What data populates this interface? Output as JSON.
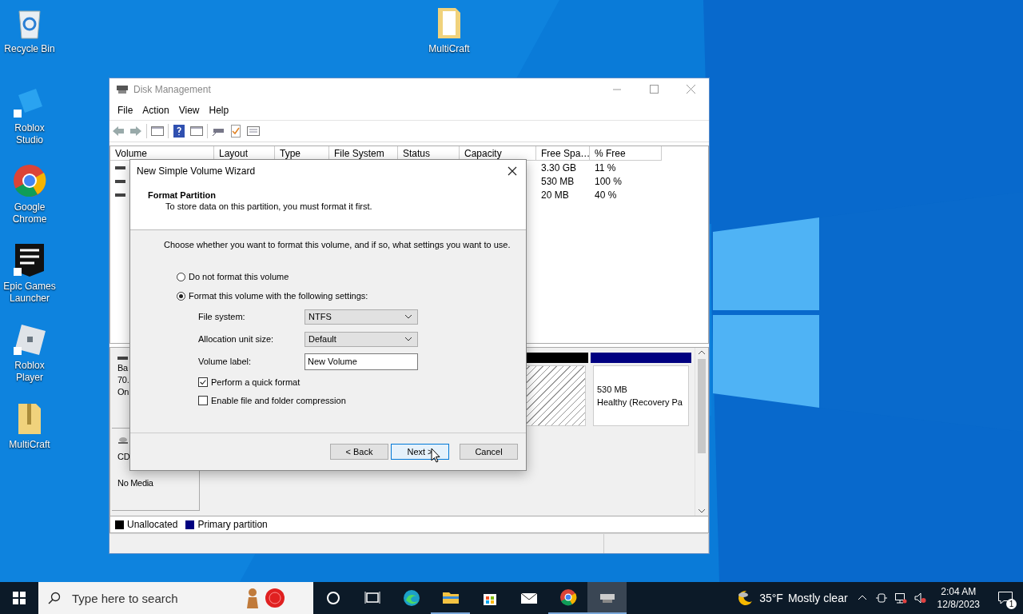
{
  "desktop_icons": [
    {
      "label": "Recycle Bin",
      "kind": "bin"
    },
    {
      "label": "Roblox Studio",
      "kind": "studio"
    },
    {
      "label": "Google Chrome",
      "kind": "chrome"
    },
    {
      "label": "Epic Games Launcher",
      "kind": "epic"
    },
    {
      "label": "Roblox Player",
      "kind": "roblox"
    },
    {
      "label": "MultiCraft",
      "kind": "zip"
    }
  ],
  "desktop_icon_top": {
    "label": "MultiCraft",
    "kind": "folder"
  },
  "window": {
    "title": "Disk Management",
    "menu": [
      "File",
      "Action",
      "View",
      "Help"
    ],
    "columns": [
      "Volume",
      "Layout",
      "Type",
      "File System",
      "Status",
      "Capacity",
      "Free Spa…",
      "% Free"
    ],
    "rows": [
      {
        "free": "3.30 GB",
        "percent": "11 %"
      },
      {
        "free": "530 MB",
        "percent": "100 %"
      },
      {
        "free": "20 MB",
        "percent": "40 %"
      }
    ],
    "disks": [
      {
        "kind": "basic",
        "lines": [
          "Ba",
          "70.",
          "On"
        ],
        "partitions": [
          {
            "kind": "unallocated",
            "color": "#000000"
          },
          {
            "kind": "primary",
            "color": "#000080",
            "size": "530 MB",
            "status": "Healthy (Recovery Pa"
          }
        ]
      },
      {
        "kind": "cdrom",
        "lines": [
          "CD",
          "No Media"
        ]
      }
    ],
    "legend": [
      {
        "label": "Unallocated",
        "color": "#000000"
      },
      {
        "label": "Primary partition",
        "color": "#000080"
      }
    ]
  },
  "dialog": {
    "title": "New Simple Volume Wizard",
    "heading": "Format Partition",
    "subheading": "To store data on this partition, you must format it first.",
    "prompt": "Choose whether you want to format this volume, and if so, what settings you want to use.",
    "options": [
      {
        "label": "Do not format this volume",
        "selected": false
      },
      {
        "label": "Format this volume with the following settings:",
        "selected": true
      }
    ],
    "fields": [
      {
        "kind": "select",
        "label": "File system:",
        "value": "NTFS"
      },
      {
        "kind": "select",
        "label": "Allocation unit size:",
        "value": "Default"
      },
      {
        "kind": "text",
        "label": "Volume label:",
        "value": "New Volume"
      }
    ],
    "checks": [
      {
        "label": "Perform a quick format",
        "checked": true
      },
      {
        "label": "Enable file and folder compression",
        "checked": false
      }
    ],
    "buttons": [
      {
        "label": "< Back",
        "focused": false
      },
      {
        "label": "Next >",
        "focused": true
      },
      {
        "label": "Cancel",
        "focused": false
      }
    ]
  },
  "taskbar": {
    "search_placeholder": "Type here to search",
    "apps": [
      {
        "kind": "cortana",
        "running": false,
        "active": false
      },
      {
        "kind": "taskview",
        "running": false,
        "active": false
      },
      {
        "kind": "edge",
        "running": false,
        "active": false
      },
      {
        "kind": "explorer",
        "running": true,
        "active": false
      },
      {
        "kind": "store",
        "running": false,
        "active": false
      },
      {
        "kind": "mail",
        "running": false,
        "active": false
      },
      {
        "kind": "chrome",
        "running": true,
        "active": false
      },
      {
        "kind": "disk",
        "running": true,
        "active": true
      }
    ],
    "weather": {
      "temp": "35°F",
      "condition": "Mostly clear"
    },
    "clock": {
      "time": "2:04 AM",
      "date": "12/8/2023"
    },
    "notifications": "1"
  }
}
